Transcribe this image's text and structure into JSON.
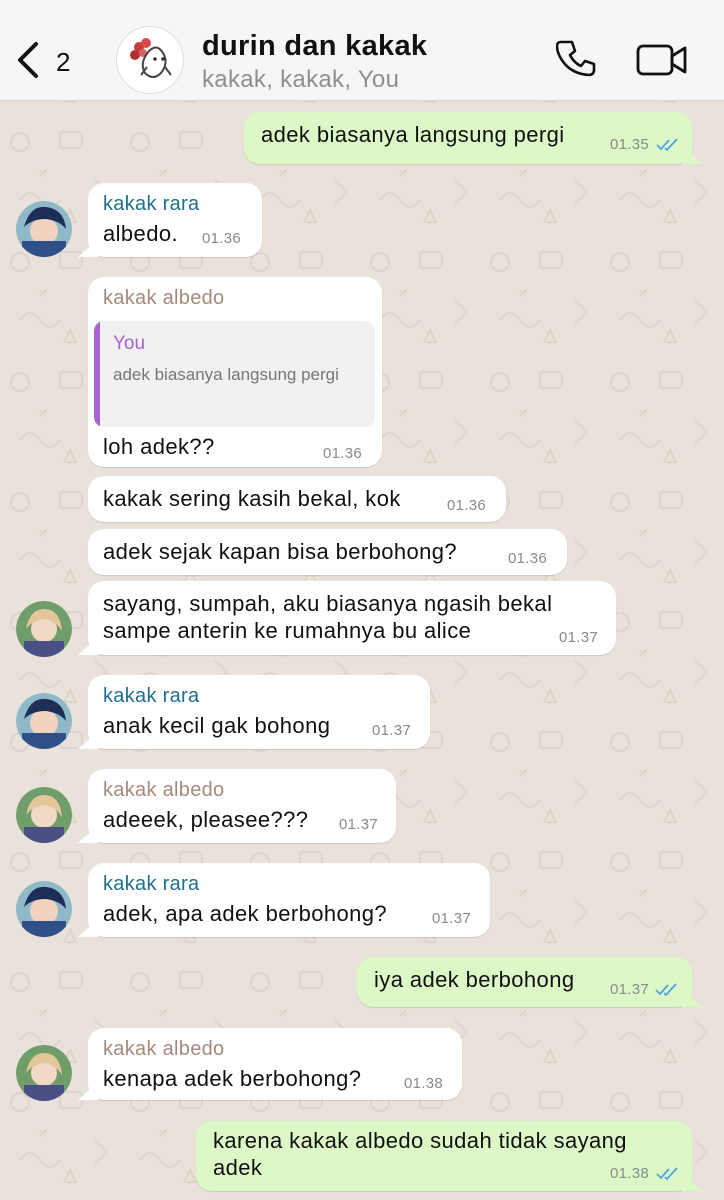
{
  "header": {
    "back_count": "2",
    "title": "durin dan kakak",
    "subtitle": "kakak, kakak, You"
  },
  "messages": [
    {
      "dir": "out",
      "text": "adek biasanya langsung pergi",
      "time": "01.35"
    },
    {
      "dir": "in",
      "sender": "kakak rara",
      "text": "albedo.",
      "time": "01.36"
    },
    {
      "dir": "in",
      "sender": "kakak albedo",
      "reply_to": {
        "name": "You",
        "text": "adek biasanya langsung pergi"
      },
      "text": "loh adek??",
      "time": "01.36"
    },
    {
      "dir": "in",
      "text": "kakak sering kasih bekal, kok",
      "time": "01.36"
    },
    {
      "dir": "in",
      "text": "adek sejak kapan bisa berbohong?",
      "time": "01.36"
    },
    {
      "dir": "in",
      "lines": [
        "sayang, sumpah, aku biasanya ngasih bekal",
        "sampe anterin ke rumahnya bu alice"
      ],
      "time": "01.37"
    },
    {
      "dir": "in",
      "sender": "kakak rara",
      "text": "anak kecil gak bohong",
      "time": "01.37"
    },
    {
      "dir": "in",
      "sender": "kakak albedo",
      "text": "adeeek, pleasee???",
      "time": "01.37"
    },
    {
      "dir": "in",
      "sender": "kakak rara",
      "text": "adek, apa adek berbohong?",
      "time": "01.37"
    },
    {
      "dir": "out",
      "text": "iya adek berbohong",
      "time": "01.37"
    },
    {
      "dir": "in",
      "sender": "kakak albedo",
      "text": "kenapa adek berbohong?",
      "time": "01.38"
    },
    {
      "dir": "out",
      "lines": [
        "karena kakak albedo sudah tidak sayang",
        "adek"
      ],
      "time": "01.38"
    }
  ],
  "colors": {
    "outgoing_bubble": "#dcf8c6",
    "incoming_bubble": "#ffffff",
    "rara_name": "#1f6f8b",
    "albedo_name": "#a48a7b",
    "reply_accent": "#a764d4",
    "read_ticks": "#4fa3e0"
  },
  "icons": [
    "chevron-left-icon",
    "group-avatar",
    "phone-icon",
    "video-camera-icon",
    "double-check-icon",
    "avatar-rara",
    "avatar-albedo"
  ]
}
